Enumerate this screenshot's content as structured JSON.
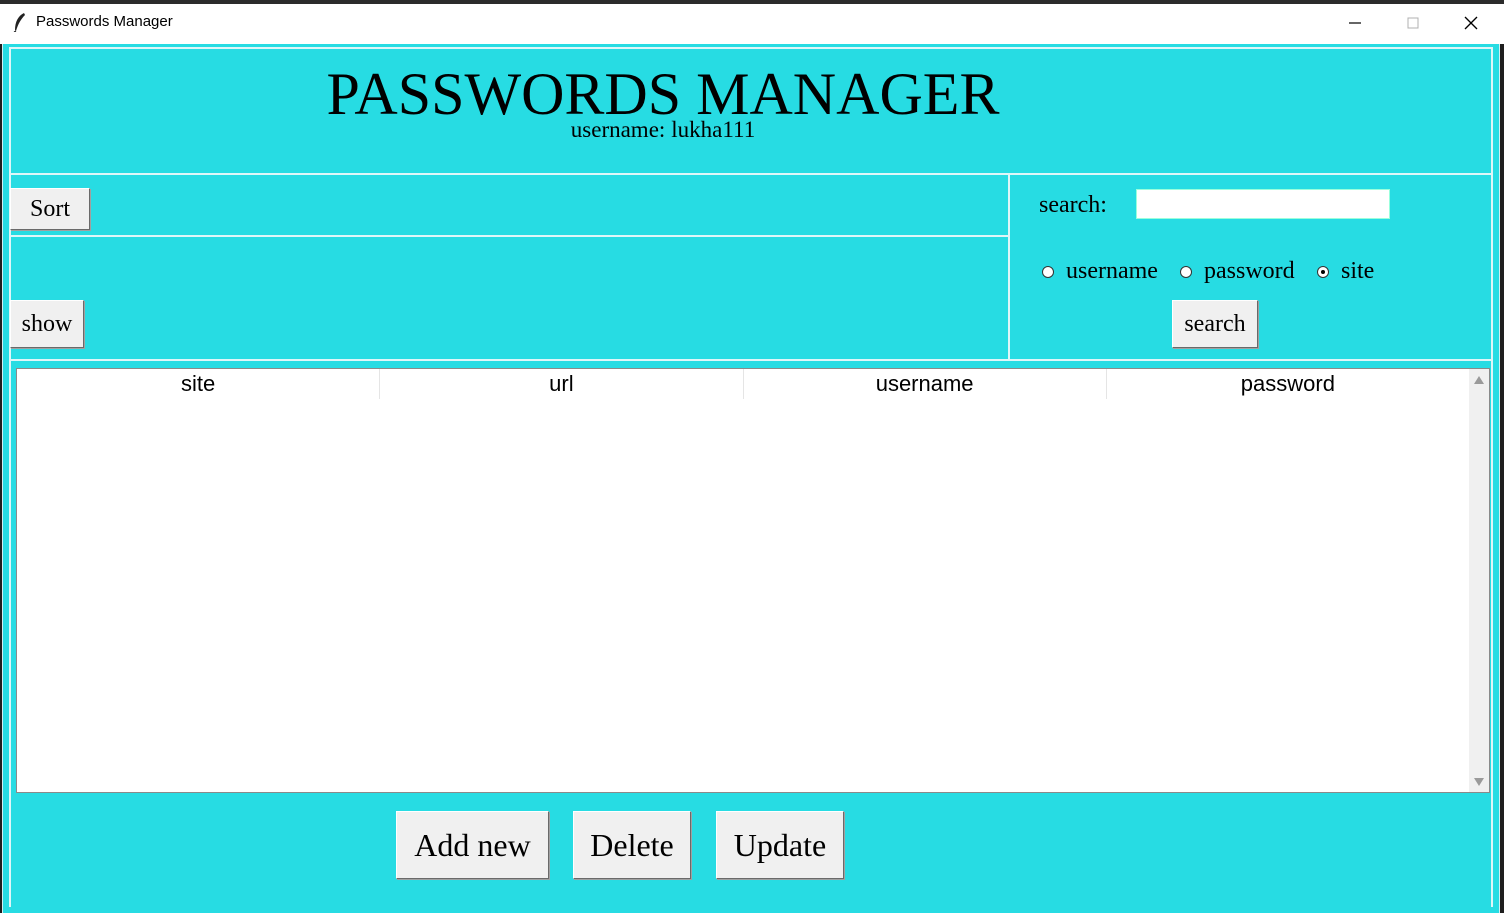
{
  "window": {
    "title": "Passwords Manager",
    "icons": {
      "app": "feather-icon",
      "minimize": "minimize-icon",
      "maximize": "maximize-icon",
      "close": "close-icon"
    }
  },
  "header": {
    "title": "PASSWORDS MANAGER",
    "user_label": "username:",
    "user_value": "lukha111"
  },
  "toolbar": {
    "sort_label": "Sort",
    "show_label": "show"
  },
  "search": {
    "label": "search:",
    "value": "",
    "options": [
      {
        "label": "username",
        "checked": false
      },
      {
        "label": "password",
        "checked": false
      },
      {
        "label": "site",
        "checked": true
      }
    ],
    "button_label": "search"
  },
  "table": {
    "columns": [
      "site",
      "url",
      "username",
      "password"
    ],
    "rows": []
  },
  "actions": {
    "add_label": "Add new",
    "delete_label": "Delete",
    "update_label": "Update"
  },
  "colors": {
    "background": "#27dce3",
    "button": "#f0f0f0"
  }
}
